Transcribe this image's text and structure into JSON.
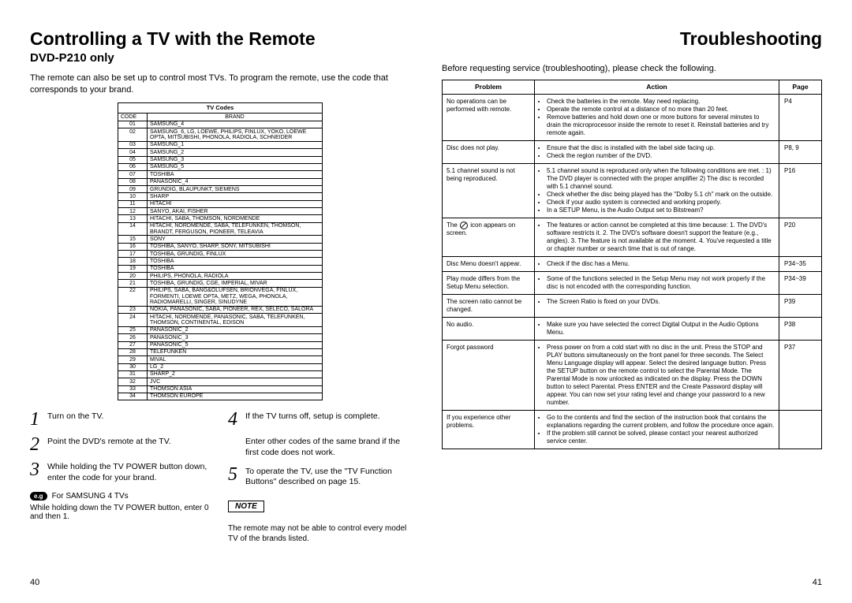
{
  "left": {
    "title": "Controlling a TV with the Remote",
    "subtitle": "DVD-P210 only",
    "intro": "The remote can also be set up to control most TVs. To program the remote, use the code that corresponds to your brand.",
    "tv_table_title": "TV Codes",
    "tv_code_hdr": "CODE",
    "tv_brand_hdr": "BRAND",
    "tv_codes": [
      {
        "code": "01",
        "brand": "SAMSUNG_4"
      },
      {
        "code": "02",
        "brand": "SAMSUNG_6, LG, LOEWE, PHILIPS, FINLUX, YOKO, LOEWE OPTA, MITSUBISHI, PHONOLA, RADIOLA, SCHNEIDER"
      },
      {
        "code": "03",
        "brand": "SAMSUNG_1"
      },
      {
        "code": "04",
        "brand": "SAMSUNG_2"
      },
      {
        "code": "05",
        "brand": "SAMSUNG_3"
      },
      {
        "code": "06",
        "brand": "SAMSUNG_5"
      },
      {
        "code": "07",
        "brand": "TOSHIBA"
      },
      {
        "code": "08",
        "brand": "PANASONIC_4"
      },
      {
        "code": "09",
        "brand": "GRUNDIG, BLAUPUNKT, SIEMENS"
      },
      {
        "code": "10",
        "brand": "SHARP"
      },
      {
        "code": "11",
        "brand": "HITACHI"
      },
      {
        "code": "12",
        "brand": "SANYO, AKAI, FISHER"
      },
      {
        "code": "13",
        "brand": "HITACHI, SABA, THOMSON, NORDMENDE"
      },
      {
        "code": "14",
        "brand": "HITACHI, NORDMENDE, SABA, TELEFUNKEN, THOMSON, BRANDT, FERGUSON, PIONEER, TELEAVIA"
      },
      {
        "code": "15",
        "brand": "SONY"
      },
      {
        "code": "16",
        "brand": "TOSHIBA, SANYO, SHARP, SONY, MITSUBISHI"
      },
      {
        "code": "17",
        "brand": "TOSHIBA, GRUNDIG, FINLUX"
      },
      {
        "code": "18",
        "brand": "TOSHIBA"
      },
      {
        "code": "19",
        "brand": "TOSHIBA"
      },
      {
        "code": "20",
        "brand": "PHILIPS, PHONOLA, RADIOLA"
      },
      {
        "code": "21",
        "brand": "TOSHIBA, GRUNDIG, CGE, IMPERIAL, MIVAR"
      },
      {
        "code": "22",
        "brand": "PHILIPS, SABA, BANG&OLUFSEN, BRIONVEGA, FINLUX, FORMENTI, LOEWE OPTA, METZ, WEGA, PHONOLA, RADIOMARELLI, SINGER, SINUDYNE"
      },
      {
        "code": "23",
        "brand": "NOKIA, PANASONIC, SABA, PIONEER, REX, SELECO, SALORA"
      },
      {
        "code": "24",
        "brand": "HITACHI, NORDMENDE, PANASONIC, SABA, TELEFUNKEN, THOMSON, CONTINENTAL, EDISON"
      },
      {
        "code": "25",
        "brand": "PANASONIC_2"
      },
      {
        "code": "26",
        "brand": "PANASONIC_3"
      },
      {
        "code": "27",
        "brand": "PANASONIC_5"
      },
      {
        "code": "28",
        "brand": "TELEFUNKEN"
      },
      {
        "code": "29",
        "brand": "MIVAL"
      },
      {
        "code": "30",
        "brand": "LG_2"
      },
      {
        "code": "31",
        "brand": "SHARP_2"
      },
      {
        "code": "32",
        "brand": "JVC"
      },
      {
        "code": "33",
        "brand": "THOMSON ASIA"
      },
      {
        "code": "34",
        "brand": "THOMSON EUROPE"
      }
    ],
    "steps": [
      "Turn on the TV.",
      "Point the DVD's remote at the TV.",
      "While holding the TV POWER button down, enter the code for your brand.",
      "If the TV turns off, setup is complete.",
      "Enter other codes of the same brand if the first code does not work.",
      "To operate the TV, use the \"TV Function Buttons\" described on page 15."
    ],
    "eg_label": "e.g",
    "eg_text": "For SAMSUNG 4 TVs",
    "eg_sub": "While holding down the TV POWER button, enter 0 and then 1.",
    "note_label": "NOTE",
    "note_text": "The remote may not be able to control every model TV of the brands listed."
  },
  "right": {
    "title": "Troubleshooting",
    "intro": "Before requesting service (troubleshooting), please check the following.",
    "hdr_problem": "Problem",
    "hdr_action": "Action",
    "hdr_page": "Page",
    "rows": [
      {
        "problem": "No operations can be performed with remote.",
        "actions": [
          "Check the batteries in the remote. May need replacing.",
          "Operate the remote control at a distance of no more than 20 feet.",
          "Remove batteries and hold down one or more buttons for several minutes to drain the microprocessor inside the remote to reset it. Reinstall batteries and try remote again."
        ],
        "page": "P4"
      },
      {
        "problem": "Disc does not play.",
        "actions": [
          "Ensure that the disc is installed with the label side facing up.",
          "Check the region number of the DVD."
        ],
        "page": "P8, 9"
      },
      {
        "problem": "5.1 channel sound is not being reproduced.",
        "actions": [
          "5.1 channel sound is reproduced only when the following conditions are met. : 1) The DVD player is connected with the proper amplifier 2) The disc is recorded with 5.1 channel sound.",
          "Check whether the disc being played has the \"Dolby 5.1 ch\" mark on the outside.",
          "Check if your audio system is connected and working properly.",
          "In a SETUP Menu, is the Audio Output set to Bitstream?"
        ],
        "page": "P16"
      },
      {
        "problem_pre": "The ",
        "problem_post": " icon appears on screen.",
        "has_icon": true,
        "actions": [
          "The features or action cannot be completed at this time because: 1. The DVD's software restricts it. 2. The DVD's software doesn't support the feature (e.g., angles). 3. The feature is not available at the moment. 4. You've requested a title or chapter number or search time that is out of range."
        ],
        "page": "P20"
      },
      {
        "problem": "Disc Menu doesn't appear.",
        "actions": [
          "Check if the disc has a Menu."
        ],
        "page": "P34~35"
      },
      {
        "problem": "Play mode differs from the Setup Menu selection.",
        "actions": [
          "Some of the functions selected in the Setup Menu may not work properly if the disc is not encoded with the corresponding function."
        ],
        "page": "P34~39"
      },
      {
        "problem": "The screen ratio cannot be changed.",
        "actions": [
          "The Screen Ratio is fixed on your DVDs."
        ],
        "page": "P39"
      },
      {
        "problem": "No audio.",
        "actions": [
          "Make sure you have selected the correct Digital Output in the Audio Options Menu."
        ],
        "page": "P38"
      },
      {
        "problem": "Forgot password",
        "actions": [
          "Press power on from a cold start with no disc in the unit. Press the STOP and PLAY buttons simultaneously on the front panel for three seconds. The Select Menu Language display will appear. Select the desired language button. Press the SETUP button on the remote control to select the Parental Mode. The Parental Mode is now unlocked as indicated on the display. Press the DOWN button to select Parental. Press ENTER and the Create Password display will appear. You can now set your rating level and change your password to a new number."
        ],
        "page": "P37"
      },
      {
        "problem": "If you experience other problems.",
        "actions": [
          "Go to the contents and find the section of the instruction book that contains the explanations regarding the current problem, and follow the procedure once again.",
          "If the problem still cannot be solved, please contact your nearest authorized service center."
        ],
        "page": ""
      }
    ]
  },
  "page_left": "40",
  "page_right": "41"
}
